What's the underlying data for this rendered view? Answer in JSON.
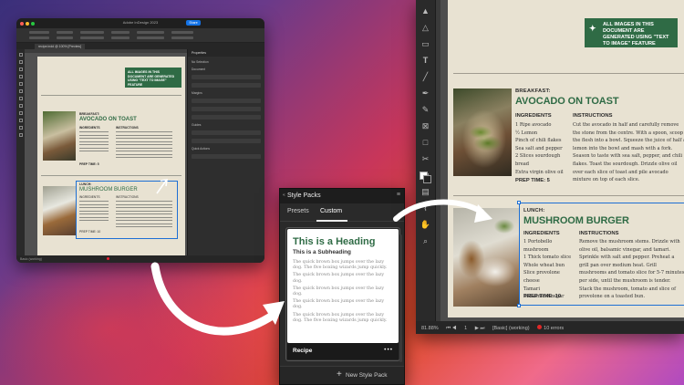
{
  "small_window": {
    "title": "Adobe InDesign 2023",
    "share_label": "Share",
    "tab_label": "recipe.indd @ 100% [Preview]",
    "panel": {
      "title": "Properties",
      "lbl1": "No Selection",
      "lbl2": "Document",
      "lbl3": "Margins",
      "lbl4": "Guides",
      "lbl5": "Quick Actions"
    },
    "status_text": "Basic (working)",
    "page": {
      "banner": "ALL IMAGES IN THIS DOCUMENT ARE GENERATED USING \"TEXT TO IMAGE\" FEATURE",
      "breakfast_label": "BREAKFAST:",
      "breakfast_title": "AVOCADO ON TOAST",
      "ingredients": "INGREDIENTS",
      "instructions": "INSTRUCTIONS",
      "prep1": "PREP TIME: 5",
      "lunch_label": "LUNCH:",
      "lunch_title": "MUSHROOM BURGER",
      "prep2": "PREP TIME: 10"
    }
  },
  "style_packs": {
    "title": "Style Packs",
    "tabs": [
      "Presets",
      "Custom"
    ],
    "active_tab": "Custom",
    "card": {
      "heading": "This is a Heading",
      "subheading": "This is a Subheading",
      "body": [
        "The quick brown box jumps over the lazy dog. The five boxing wizards jump quickly.",
        "The quick brown box jumps over the lazy dog.",
        "The quick brown box jumps over the lazy dog.",
        "The quick brown box jumps over the lazy dog.",
        "The quick brown box jumps over the lazy dog. The five boxing wizards jump quickly."
      ],
      "name": "Recipe",
      "more": "•••"
    },
    "new_pack": "New Style Pack"
  },
  "big_window": {
    "page": {
      "banner": "ALL IMAGES IN THIS DOCUMENT ARE GENERATED USING \"TEXT TO IMAGE\" FEATURE",
      "breakfast": {
        "label": "BREAKFAST:",
        "title": "AVOCADO ON TOAST",
        "ingredients_head": "INGREDIENTS",
        "ingredients": [
          "1 Ripe avocado",
          "½ Lemon",
          "Pinch of chili flakes",
          "Sea salt and pepper",
          "2 Slices sourdough bread",
          "Extra virgin olive oil"
        ],
        "instructions_head": "INSTRUCTIONS",
        "instructions": "Cut the avocado in half and carefully remove the stone from the centre. With a spoon, scoop the flesh into a bowl. Squeeze the juice of half a lemon into the bowl and mash with a fork. Season to taste with sea salt, pepper, and chili flakes. Toast the sourdough. Drizzle olive oil over each slice of toast and pile avocado mixture on top of each slice.",
        "prep": "PREP TIME: 5"
      },
      "lunch": {
        "label": "LUNCH:",
        "title": "MUSHROOM BURGER",
        "ingredients_head": "INGREDIENTS",
        "ingredients": [
          "1 Portobello mushroom",
          "1 Thick tomato slice",
          "Whole wheat bun",
          "Slice provolone cheese",
          "Tamari",
          "Balsamic vinegar"
        ],
        "instructions_head": "INSTRUCTIONS",
        "instructions": "Remove the mushroom stems. Drizzle with olive oil, balsamic vinegar, and tamari. Sprinkle with salt and pepper. Preheat a grill pan over medium heat. Grill mushrooms and tomato slice for 5-7 minutes per side, until the mushroom is tender. Stack the mushroom, tomato and slice of provolone on a toasted bun.",
        "prep": "PREP TIME: 10"
      }
    },
    "status": {
      "zoom": "81.88%",
      "page": "1",
      "style": "[Basic] (working)",
      "errors": "10 errors"
    }
  }
}
